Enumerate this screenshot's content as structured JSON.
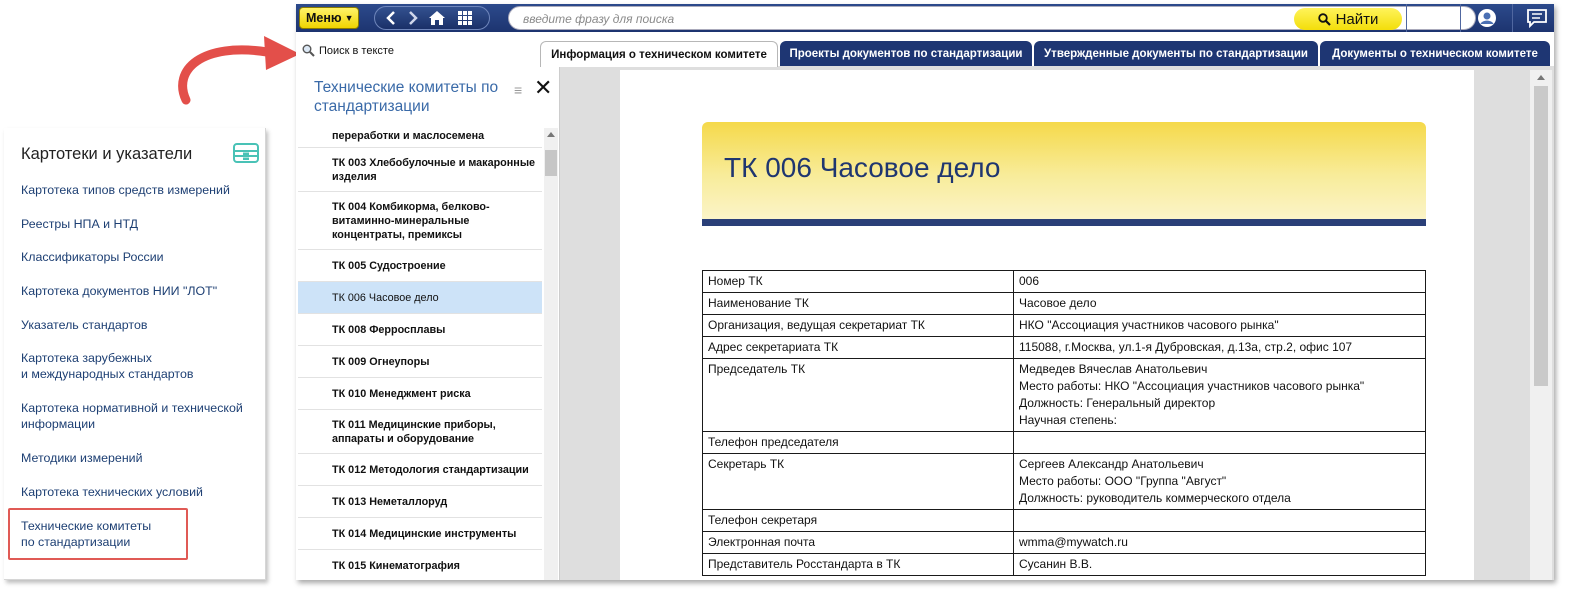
{
  "sidebar": {
    "title": "Картотеки и указатели",
    "title_icon": "archive-tray-icon",
    "items": [
      {
        "label": "Картотека типов средств измерений"
      },
      {
        "label": "Реестры НПА и НТД"
      },
      {
        "label": "Классификаторы России"
      },
      {
        "label": "Картотека документов НИИ \"ЛОТ\""
      },
      {
        "label": "Указатель стандартов"
      },
      {
        "label": "Картотека зарубежных\nи международных стандартов"
      },
      {
        "label": "Картотека нормативной и технической информации"
      },
      {
        "label": "Методики измерений"
      },
      {
        "label": "Картотека технических условий"
      },
      {
        "label": "Технические комитеты\nпо стандартизации"
      }
    ],
    "highlight_color": "#e05a55"
  },
  "toolbar": {
    "menu_label": "Меню",
    "search_placeholder": "введите фразу для поиска",
    "find_label": "Найти",
    "accent": "#f3de0a",
    "bar_color": "#1d3470"
  },
  "tabs_row": {
    "search_in_text": "Поиск в тексте",
    "tabs": [
      {
        "label": "Информация о техническом комитете",
        "active": true
      },
      {
        "label": "Проекты документов по стандартизации",
        "active": false
      },
      {
        "label": "Утвержденные документы по стандартизации",
        "active": false
      },
      {
        "label": "Документы о техническом комитете",
        "active": false
      }
    ]
  },
  "list_panel": {
    "title": "Технические комитеты по стандартизации",
    "items": [
      {
        "label": "переработки и маслосемена",
        "selected": false
      },
      {
        "label": "ТК 003 Хлебобулочные и макаронные изделия",
        "selected": false
      },
      {
        "label": "ТК 004 Комбикорма, белково-витаминно-минеральные концентраты, премиксы",
        "selected": false
      },
      {
        "label": "ТК 005 Судостроение",
        "selected": false
      },
      {
        "label": "ТК 006 Часовое дело",
        "selected": true
      },
      {
        "label": "ТК 008 Ферросплавы",
        "selected": false
      },
      {
        "label": "ТК 009 Огнеупоры",
        "selected": false
      },
      {
        "label": "ТК 010 Менеджмент риска",
        "selected": false
      },
      {
        "label": "ТК 011 Медицинские приборы, аппараты и оборудование",
        "selected": false
      },
      {
        "label": "ТК 012 Методология стандартизации",
        "selected": false
      },
      {
        "label": "ТК 013 Неметаллоруд",
        "selected": false
      },
      {
        "label": "ТК 014 Медицинские инструменты",
        "selected": false
      },
      {
        "label": "ТК 015 Кинематография",
        "selected": false
      }
    ]
  },
  "document": {
    "title": "ТК 006 Часовое дело",
    "rows": [
      {
        "key": "Номер ТК",
        "value": "006"
      },
      {
        "key": "Наименование ТК",
        "value": "Часовое дело"
      },
      {
        "key": "Организация, ведущая секретариат ТК",
        "value": "НКО \"Ассоциация участников часового рынка\""
      },
      {
        "key": "Адрес секретариата ТК",
        "value": "115088, г.Москва, ул.1-я Дубровская, д.13а, стр.2, офис 107"
      },
      {
        "key": "Председатель ТК",
        "value": "Медведев Вячеслав Анатольевич\nМесто работы: НКО \"Ассоциация участников часового рынка\"\nДолжность: Генеральный директор\nНаучная степень:"
      },
      {
        "key": "Телефон председателя",
        "value": ""
      },
      {
        "key": "Секретарь ТК",
        "value": "Сергеев Александр Анатольевич\nМесто работы: ООО \"Группа \"Август\"\nДолжность: руководитель коммерческого отдела"
      },
      {
        "key": "Телефон секретаря",
        "value": ""
      },
      {
        "key": "Электронная почта",
        "value": "wmma@mywatch.ru"
      },
      {
        "key": "Представитель Росстандарта в ТК",
        "value": "Сусанин В.В."
      }
    ]
  }
}
